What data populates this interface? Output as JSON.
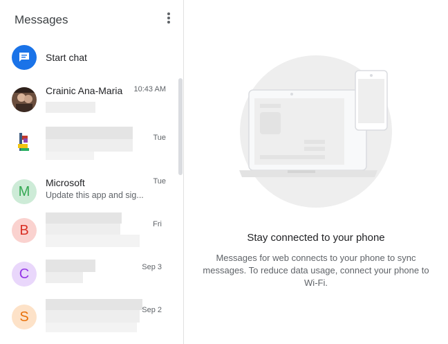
{
  "sidebar": {
    "title": "Messages",
    "menu_icon": "more-vert-icon",
    "start_chat": {
      "label": "Start chat",
      "icon": "chat-bubble-icon",
      "color": "#1a73e8"
    },
    "conversations": [
      {
        "name": "Crainic Ana-Maria",
        "snippet": "",
        "time": "10:43 AM",
        "avatar": "photo"
      },
      {
        "name": "",
        "snippet": "",
        "time": "Tue",
        "avatar": "image"
      },
      {
        "name": "Microsoft",
        "snippet": "Update this app and sig...",
        "time": "Tue",
        "avatar_letter": "M",
        "avatar_bg": "#cdebd7",
        "avatar_fg": "#34a853"
      },
      {
        "name": "",
        "snippet": "",
        "time": "Fri",
        "avatar_letter": "B",
        "avatar_bg": "#fad2cf",
        "avatar_fg": "#d93025"
      },
      {
        "name": "",
        "snippet": "",
        "time": "Sep 3",
        "avatar_letter": "C",
        "avatar_bg": "#e9d7fb",
        "avatar_fg": "#9334e6"
      },
      {
        "name": "",
        "snippet": "",
        "time": "Sep 2",
        "avatar_letter": "S",
        "avatar_bg": "#fde2c8",
        "avatar_fg": "#e8710a"
      }
    ]
  },
  "main": {
    "title": "Stay connected to your phone",
    "description": "Messages for web connects to your phone to sync messages. To reduce data usage, connect your phone to Wi-Fi.",
    "illustration": "laptop-and-phone-illustration"
  }
}
